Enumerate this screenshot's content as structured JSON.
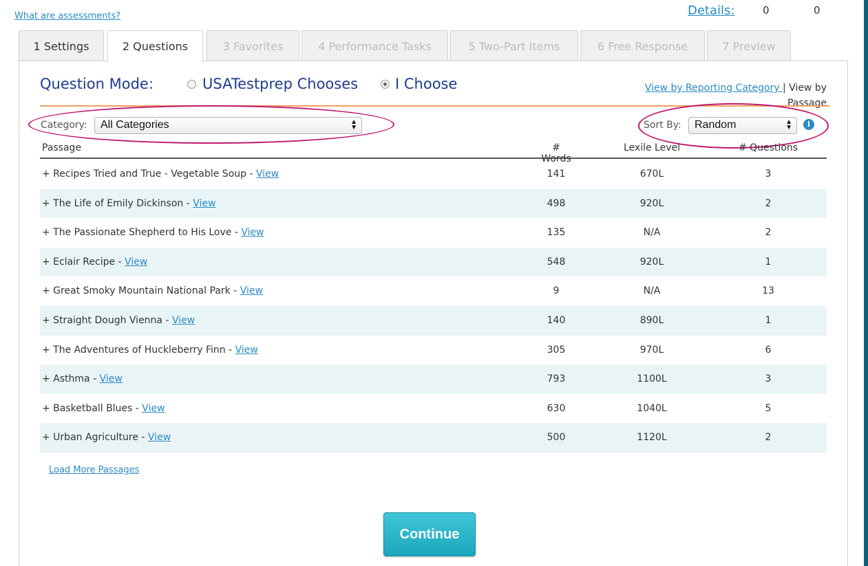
{
  "top_link": "What are assessments?",
  "details": {
    "label": "Details:",
    "value1": "0",
    "value2": "0"
  },
  "tabs": [
    {
      "label": "1 Settings"
    },
    {
      "label": "2 Questions"
    },
    {
      "label": "3 Favorites"
    },
    {
      "label": "4 Performance Tasks"
    },
    {
      "label": "5 Two-Part Items"
    },
    {
      "label": "6 Free Response"
    },
    {
      "label": "7 Preview"
    }
  ],
  "question_mode": {
    "label": "Question Mode:",
    "option1": "USATestprep Chooses",
    "option2": "I Choose",
    "selected": "I Choose"
  },
  "view_links": {
    "reporting": "View by Reporting Category ",
    "separator": "|",
    "passage": " View by Passage"
  },
  "filters": {
    "category_label": "Category:",
    "category_value": "All Categories",
    "sort_label": "Sort By:",
    "sort_value": "Random"
  },
  "table": {
    "headers": {
      "passage": "Passage",
      "words": "# Words",
      "lexile": "Lexile Level",
      "questions": "# Questions"
    },
    "rows": [
      {
        "title": "+ Recipes Tried and True - Vegetable Soup - ",
        "link": "View",
        "words": "141",
        "lexile": "670L",
        "questions": "3"
      },
      {
        "title": "+ The Life of Emily Dickinson - ",
        "link": "View",
        "words": "498",
        "lexile": "920L",
        "questions": "2"
      },
      {
        "title": "+ The Passionate Shepherd to His Love - ",
        "link": "View",
        "words": "135",
        "lexile": "N/A",
        "questions": "2"
      },
      {
        "title": "+ Eclair Recipe - ",
        "link": "View",
        "words": "548",
        "lexile": "920L",
        "questions": "1"
      },
      {
        "title": "+ Great Smoky Mountain National Park - ",
        "link": "View",
        "words": "9",
        "lexile": "N/A",
        "questions": "13"
      },
      {
        "title": "+ Straight Dough Vienna - ",
        "link": "View",
        "words": "140",
        "lexile": "890L",
        "questions": "1"
      },
      {
        "title": "+ The Adventures of Huckleberry Finn - ",
        "link": "View",
        "words": "305",
        "lexile": "970L",
        "questions": "6"
      },
      {
        "title": "+ Asthma - ",
        "link": "View",
        "words": "793",
        "lexile": "1100L",
        "questions": "3"
      },
      {
        "title": "+ Basketball Blues - ",
        "link": "View",
        "words": "630",
        "lexile": "1040L",
        "questions": "5"
      },
      {
        "title": "+ Urban Agriculture - ",
        "link": "View",
        "words": "500",
        "lexile": "1120L",
        "questions": "2"
      }
    ]
  },
  "load_more": "Load More Passages",
  "continue_label": "Continue",
  "icons": {
    "info": "info-icon",
    "select_arrows": "select-arrows-icon"
  },
  "colors": {
    "accent": "#2a8ac4",
    "heading": "#1f3b8c",
    "highlight_ellipse": "#c0196f",
    "continue": "#1ba7bc",
    "row_alt": "#e9f4f6"
  }
}
